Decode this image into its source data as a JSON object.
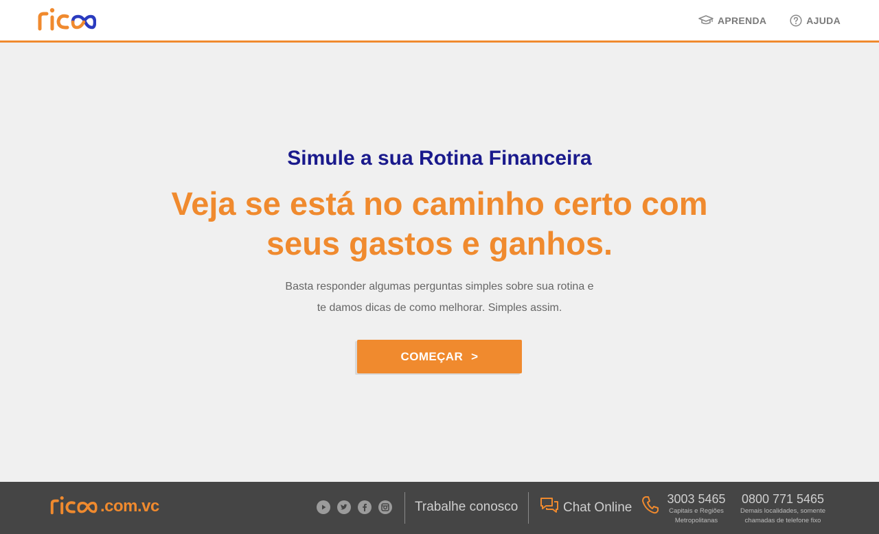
{
  "header": {
    "logo_text": "rico",
    "nav": [
      {
        "label": "APRENDA",
        "icon": "graduation-cap-icon"
      },
      {
        "label": "AJUDA",
        "icon": "question-circle-icon"
      }
    ]
  },
  "hero": {
    "kicker": "Simule a sua Rotina Financeira",
    "headline_line1": "Veja se está no caminho certo com",
    "headline_line2": "seus gastos e ganhos.",
    "desc_line1": "Basta responder algumas perguntas simples sobre sua rotina e",
    "desc_line2": "te damos dicas de como melhorar. Simples assim.",
    "cta_label": "COMEÇAR",
    "cta_arrow": ">"
  },
  "footer": {
    "logo_text": "rico",
    "logo_domain": ".com.vc",
    "socials": [
      "youtube-icon",
      "twitter-icon",
      "facebook-icon",
      "instagram-icon"
    ],
    "work_label": "Trabalhe conosco",
    "chat_label": "Chat Online",
    "phones": [
      {
        "number": "3003 5465",
        "note_line1": "Capitais e Regiões",
        "note_line2": "Metropolitanas"
      },
      {
        "number": "0800 771 5465",
        "note_line1": "Demais localidades, somente",
        "note_line2": "chamadas de telefone fixo"
      }
    ]
  },
  "colors": {
    "brand_orange": "#f08a2e",
    "brand_blue": "#1a1a8c",
    "footer_bg": "#454545",
    "hero_bg": "#f0f0f0"
  }
}
